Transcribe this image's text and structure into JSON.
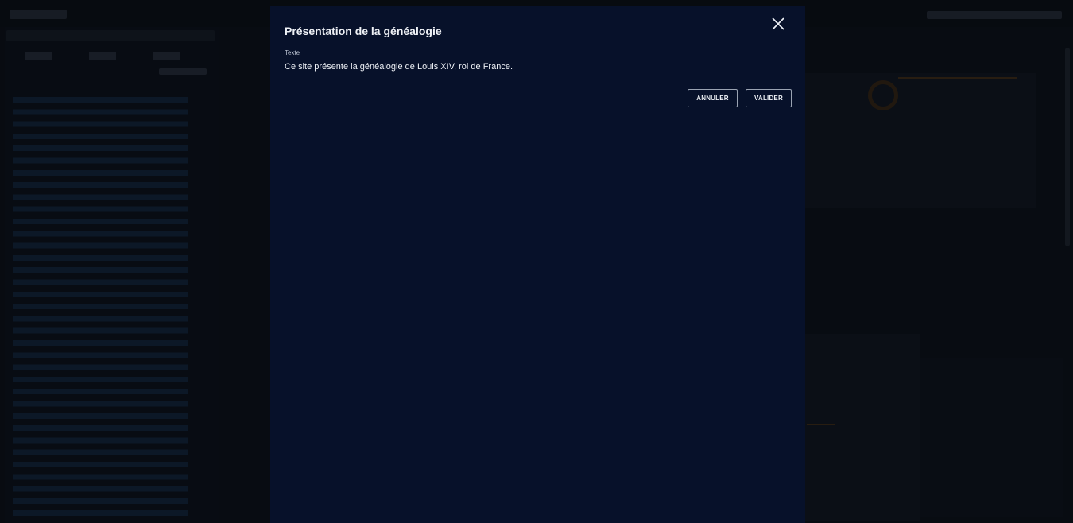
{
  "dialog": {
    "title": "Présentation de la généalogie",
    "field_label": "Texte",
    "field_value": "Ce site présente la généalogie de Louis XIV, roi de France.",
    "cancel_label": "ANNULER",
    "ok_label": "VALIDER"
  },
  "icons": {
    "close": "close-icon"
  },
  "colors": {
    "dialog_background": "#07112a",
    "page_background": "#0f1520",
    "text": "#eef1f6"
  }
}
